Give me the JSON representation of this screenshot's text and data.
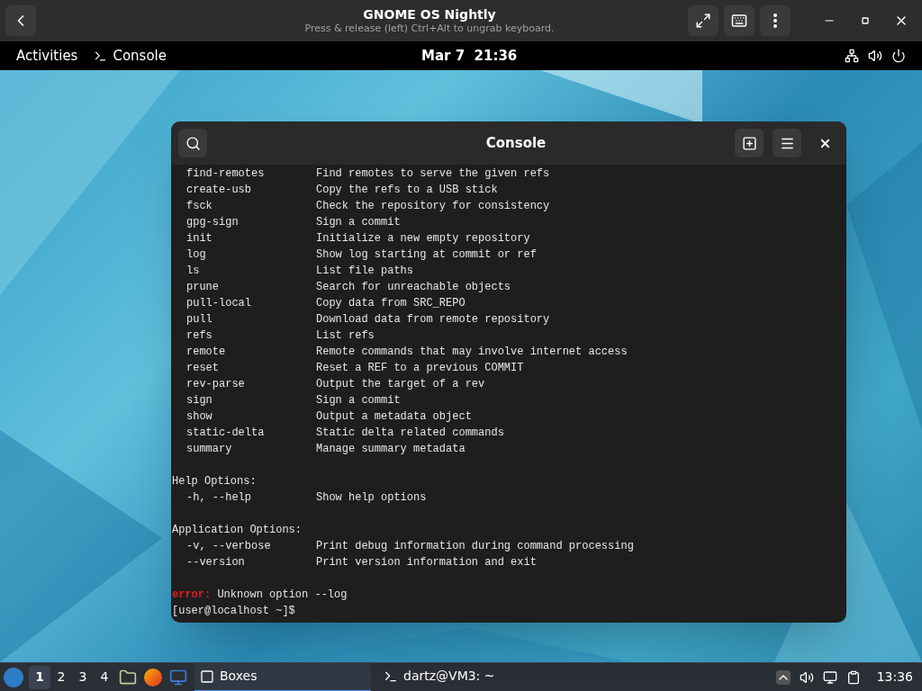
{
  "vm_window": {
    "title": "GNOME OS Nightly",
    "subtitle": "Press & release (left) Ctrl+Alt to ungrab keyboard."
  },
  "top_bar": {
    "activities": "Activities",
    "app": "Console",
    "clock": "Mar 7  21:36"
  },
  "console": {
    "title": "Console",
    "lines": [
      {
        "kind": "command",
        "name": "find-remotes",
        "text": "Find remotes to serve the given refs"
      },
      {
        "kind": "command",
        "name": "create-usb",
        "text": "Copy the refs to a USB stick"
      },
      {
        "kind": "command",
        "name": "fsck",
        "text": "Check the repository for consistency"
      },
      {
        "kind": "command",
        "name": "gpg-sign",
        "text": "Sign a commit"
      },
      {
        "kind": "command",
        "name": "init",
        "text": "Initialize a new empty repository"
      },
      {
        "kind": "command",
        "name": "log",
        "text": "Show log starting at commit or ref"
      },
      {
        "kind": "command",
        "name": "ls",
        "text": "List file paths"
      },
      {
        "kind": "command",
        "name": "prune",
        "text": "Search for unreachable objects"
      },
      {
        "kind": "command",
        "name": "pull-local",
        "text": "Copy data from SRC_REPO"
      },
      {
        "kind": "command",
        "name": "pull",
        "text": "Download data from remote repository"
      },
      {
        "kind": "command",
        "name": "refs",
        "text": "List refs"
      },
      {
        "kind": "command",
        "name": "remote",
        "text": "Remote commands that may involve internet access"
      },
      {
        "kind": "command",
        "name": "reset",
        "text": "Reset a REF to a previous COMMIT"
      },
      {
        "kind": "command",
        "name": "rev-parse",
        "text": "Output the target of a rev"
      },
      {
        "kind": "command",
        "name": "sign",
        "text": "Sign a commit"
      },
      {
        "kind": "command",
        "name": "show",
        "text": "Output a metadata object"
      },
      {
        "kind": "command",
        "name": "static-delta",
        "text": "Static delta related commands"
      },
      {
        "kind": "command",
        "name": "summary",
        "text": "Manage summary metadata"
      },
      {
        "kind": "blank"
      },
      {
        "kind": "heading",
        "text": "Help Options:"
      },
      {
        "kind": "command",
        "name": "-h, --help",
        "text": "Show help options"
      },
      {
        "kind": "blank"
      },
      {
        "kind": "heading",
        "text": "Application Options:"
      },
      {
        "kind": "command",
        "name": "-v, --verbose",
        "text": "Print debug information during command processing"
      },
      {
        "kind": "command",
        "name": "--version",
        "text": "Print version information and exit"
      },
      {
        "kind": "blank"
      },
      {
        "kind": "error",
        "label": "error:",
        "text": "Unknown option --log"
      },
      {
        "kind": "prompt",
        "text": "[user@localhost ~]$"
      }
    ]
  },
  "taskbar": {
    "workspaces": [
      {
        "label": "1",
        "selected": true
      },
      {
        "label": "2",
        "selected": false
      },
      {
        "label": "3",
        "selected": false
      },
      {
        "label": "4",
        "selected": false
      }
    ],
    "tasks": [
      {
        "label": "Boxes",
        "selected": true
      },
      {
        "label": "dartz@VM3: ~",
        "selected": false
      }
    ],
    "clock": "13:36"
  }
}
